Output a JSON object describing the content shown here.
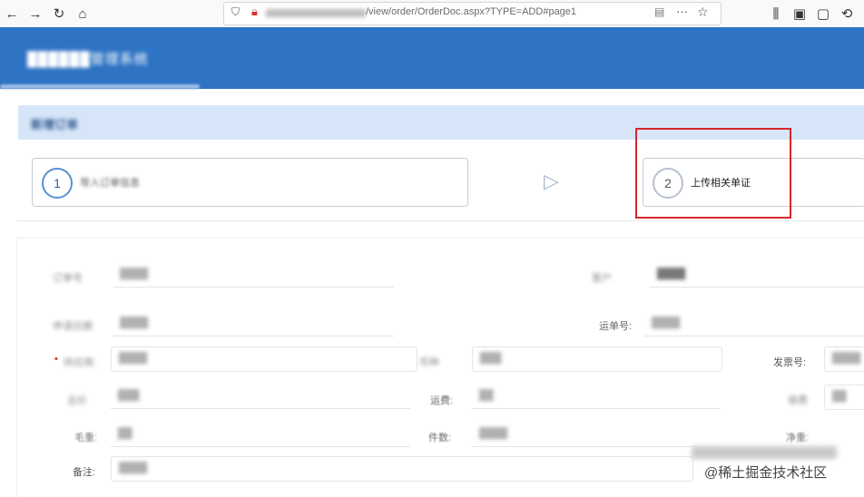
{
  "browser": {
    "nav_icons": [
      "back-arrow",
      "forward-arrow",
      "reload",
      "home"
    ],
    "url_text": "/view/order/OrderDoc.aspx?TYPE=ADD#page1",
    "toolbar_icons": [
      "library",
      "sidebar",
      "pocket",
      "history"
    ]
  },
  "app": {
    "title": "██████管理系统"
  },
  "section": {
    "title": "新增订单"
  },
  "steps": [
    {
      "number": "1",
      "label": "导入订单信息"
    },
    {
      "number": "2",
      "label": "上传相关单证"
    }
  ],
  "form": {
    "row1": {
      "label_left": "订单号",
      "value_left": "████",
      "label_right": "客户",
      "value_right": "████"
    },
    "row2": {
      "label_left": "申请日期",
      "value_left": "████",
      "label_right": "运单号:",
      "value_right": "████"
    },
    "row3": {
      "label_left": "供应商:",
      "value_left": "████",
      "label_mid": "币种",
      "value_mid": "███",
      "label_right": "发票号:",
      "value_right": "████"
    },
    "row4": {
      "label_left": "总价",
      "value_left": "███",
      "label_mid": "运费:",
      "value_mid": "██",
      "label_right": "保费",
      "value_right": "██"
    },
    "row5": {
      "label_left": "毛重:",
      "value_left": "██",
      "label_mid": "件数:",
      "value_mid": "████",
      "label_right": "净重:",
      "value_right": ""
    },
    "row6": {
      "label_left": "备注:",
      "value_left": "████"
    }
  },
  "watermark": "@稀土掘金技术社区"
}
